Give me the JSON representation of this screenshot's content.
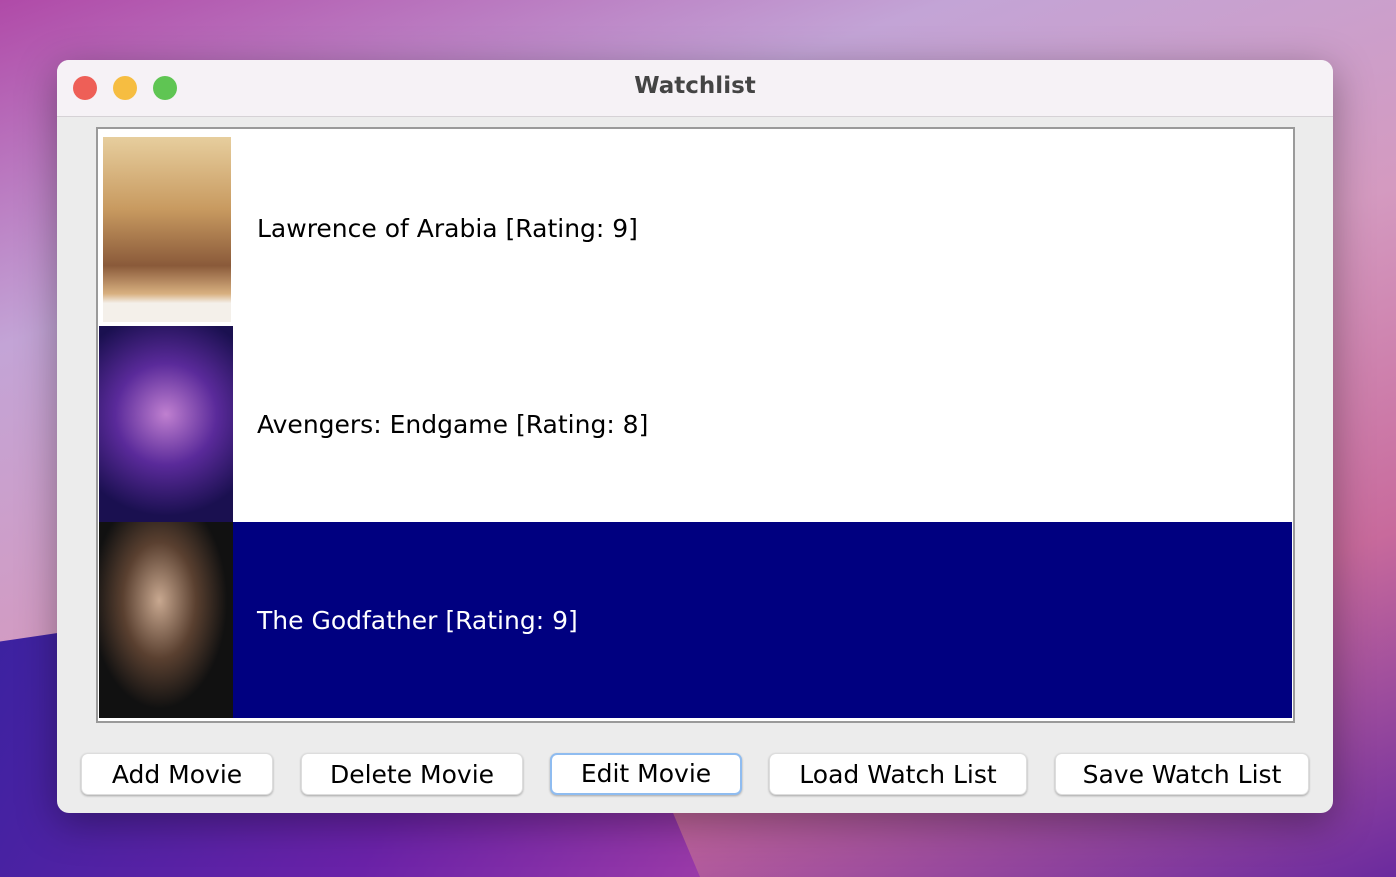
{
  "window": {
    "title": "Watchlist"
  },
  "traffic_lights": {
    "close": "#ee5f57",
    "minimize": "#f6bd41",
    "zoom": "#5fc553"
  },
  "list": {
    "selected_color": "#000080",
    "items": [
      {
        "label": "Lawrence of Arabia [Rating: 9]",
        "poster": "Lawrence of Arabia poster",
        "selected": false
      },
      {
        "label": "Avengers: Endgame [Rating: 8]",
        "poster": "Avengers: Endgame poster",
        "selected": false
      },
      {
        "label": "The Godfather [Rating: 9]",
        "poster": "The Godfather poster",
        "selected": true
      }
    ]
  },
  "buttons": {
    "add": "Add Movie",
    "delete": "Delete Movie",
    "edit": "Edit Movie",
    "load": "Load Watch List",
    "save": "Save Watch List"
  }
}
